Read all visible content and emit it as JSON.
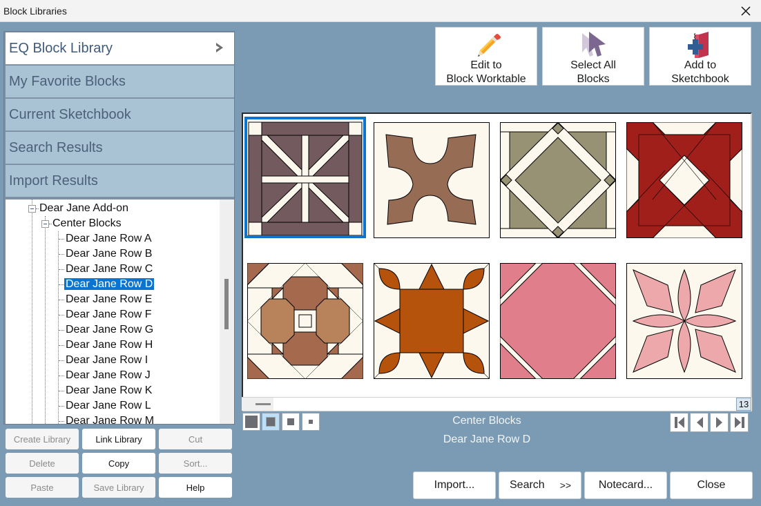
{
  "window": {
    "title": "Block Libraries",
    "close_icon": "close-icon"
  },
  "libraries": {
    "items": [
      {
        "label": "EQ Block Library",
        "active": true
      },
      {
        "label": "My Favorite Blocks",
        "active": false
      },
      {
        "label": "Current Sketchbook",
        "active": false
      },
      {
        "label": "Search Results",
        "active": false
      },
      {
        "label": "Import Results",
        "active": false
      }
    ],
    "chevron_icon": "chevron-right-icon"
  },
  "tree": {
    "parent": "Dear Jane Add-on",
    "child": "Center Blocks",
    "items": [
      "Dear Jane Row A",
      "Dear Jane Row B",
      "Dear Jane Row C",
      "Dear Jane Row D",
      "Dear Jane Row E",
      "Dear Jane Row F",
      "Dear Jane Row G",
      "Dear Jane Row H",
      "Dear Jane Row I",
      "Dear Jane Row J",
      "Dear Jane Row K",
      "Dear Jane Row L",
      "Dear Jane Row M"
    ],
    "selected": "Dear Jane Row D"
  },
  "library_buttons": [
    {
      "label": "Create Library",
      "enabled": false
    },
    {
      "label": "Link Library",
      "enabled": true
    },
    {
      "label": "Cut",
      "enabled": false
    },
    {
      "label": "Delete",
      "enabled": false
    },
    {
      "label": "Copy",
      "enabled": true
    },
    {
      "label": "Sort...",
      "enabled": false
    },
    {
      "label": "Paste",
      "enabled": false
    },
    {
      "label": "Save Library",
      "enabled": false
    },
    {
      "label": "Help",
      "enabled": true
    }
  ],
  "toolbar": {
    "edit": {
      "line1": "Edit to",
      "line2": "Block Worktable",
      "icon": "pencil-icon"
    },
    "select_all": {
      "line1": "Select All",
      "line2": "Blocks",
      "icon": "cursor-arrows-icon"
    },
    "add": {
      "line1": "Add to",
      "line2": "Sketchbook",
      "icon": "sketchbook-add-icon"
    }
  },
  "blocks": {
    "selected_index": 0,
    "colors": {
      "background": "#fdf8ee",
      "plum": "#725a5e",
      "brown": "#966c55",
      "sage": "#989274",
      "red": "#a01f1b",
      "terracotta": "#a56a4e",
      "tan": "#b8825a",
      "rust": "#b5520b",
      "pink": "#e07f8b",
      "light_pink": "#eca8aa",
      "selection": "#0a74d0"
    },
    "count": 8
  },
  "grid": {
    "page_counter": "13"
  },
  "status": {
    "category": "Center Blocks",
    "block_name": "Dear Jane Row D"
  },
  "size_options": {
    "selected_index": 1,
    "count": 4
  },
  "navigation": {
    "icons": [
      "first-page-icon",
      "previous-page-icon",
      "next-page-icon",
      "last-page-icon"
    ]
  },
  "bottom_buttons": {
    "import": "Import...",
    "search": "Search",
    "search_arrows": ">>",
    "notecard": "Notecard...",
    "close": "Close"
  }
}
